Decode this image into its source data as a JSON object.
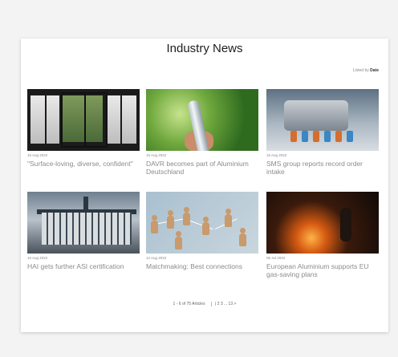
{
  "page": {
    "title": "Industry News",
    "sort_prefix": "Listed by",
    "sort_value": "Date"
  },
  "articles": [
    {
      "date": "15 Aug 2022",
      "headline": "\"Surface-loving, diverse, confident\"",
      "image": "glass-doors-garden-photo"
    },
    {
      "date": "15 Aug 2022",
      "headline": "DAVR becomes part of Aluminium Deutschland",
      "image": "aluminium-bottle-photo"
    },
    {
      "date": "15 Aug 2022",
      "headline": "SMS group reports record order intake",
      "image": "industrial-plant-photo"
    },
    {
      "date": "15 Aug 2022",
      "headline": "HAI gets further ASI certification",
      "image": "factory-building-photo"
    },
    {
      "date": "12 Aug 2022",
      "headline": "Matchmaking: Best connections",
      "image": "wooden-figures-network-photo"
    },
    {
      "date": "08 Jul 2022",
      "headline": "European Aluminium supports EU gas-saving plans",
      "image": "furnace-worker-photo"
    }
  ],
  "pagination": {
    "summary": "1 - 6 of 75 Articles",
    "pages": "| 2 3 ... 13 >"
  }
}
